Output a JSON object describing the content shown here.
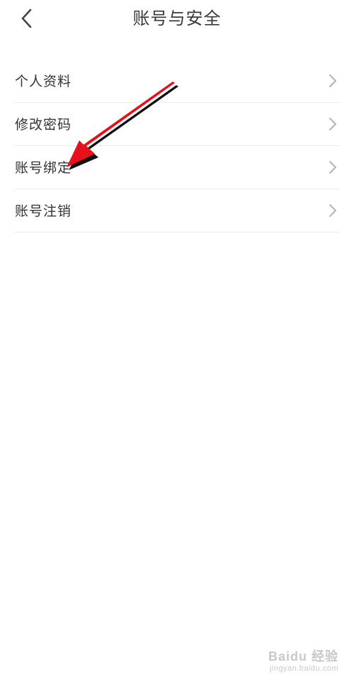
{
  "header": {
    "title": "账号与安全",
    "back_icon": "chevron-left-icon"
  },
  "menu": {
    "items": [
      {
        "label": "个人资料",
        "icon": "chevron-right-icon"
      },
      {
        "label": "修改密码",
        "icon": "chevron-right-icon"
      },
      {
        "label": "账号绑定",
        "icon": "chevron-right-icon"
      },
      {
        "label": "账号注销",
        "icon": "chevron-right-icon"
      }
    ]
  },
  "annotation": {
    "type": "red-arrow",
    "color": "#e8101a",
    "points_to": "账号绑定"
  },
  "watermark": {
    "logo": "Baidu 经验",
    "url": "jingyan.baidu.com"
  },
  "colors": {
    "background": "#ffffff",
    "text": "#333333",
    "divider": "#ebebeb",
    "chevron": "#b3b3b3"
  }
}
